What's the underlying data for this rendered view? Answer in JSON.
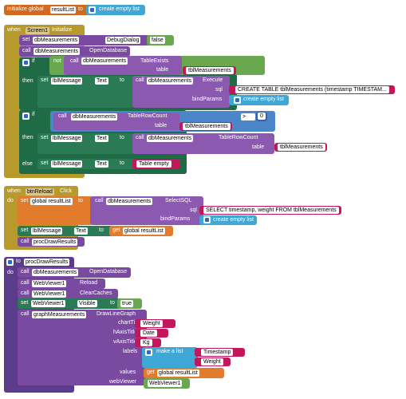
{
  "b1": {
    "initialize": "initialize global",
    "var": "resultList",
    "to": "to",
    "create": "create empty list"
  },
  "b2": {
    "when": "when",
    "component": "Screen1",
    "event": "Initialize",
    "do": "do",
    "set1": {
      "set": "set",
      "comp": "dbMeasurements",
      "prop": "DebugDialog",
      "to": "to",
      "value": "false"
    },
    "call1": {
      "call": "call",
      "comp": "dbMeasurements",
      "method": "OpenDatabase"
    },
    "if1": {
      "if": "if",
      "not": "not",
      "call": "call",
      "comp": "dbMeasurements",
      "method": "TableExists",
      "table": "table",
      "tbl": "tblMeasurements"
    },
    "then1": {
      "then": "then",
      "set": "set",
      "lbl": "lblMessage",
      "prop": "Text",
      "to": "to",
      "call": "call",
      "comp": "dbMeasurements",
      "method": "Execute",
      "sql": "sql",
      "sqlText": "CREATE TABLE tblMeasurements (timestamp TIMESTAM...",
      "bindParams": "bindParams",
      "create": "create empty list"
    },
    "if2": {
      "if": "if",
      "call": "call",
      "comp": "dbMeasurements",
      "method": "TableRowCount",
      "table": "table",
      "tbl": "tblMeasurements",
      "op": ">",
      "num": "0"
    },
    "then2": {
      "then": "then",
      "set": "set",
      "lbl": "lblMessage",
      "prop": "Text",
      "to": "to",
      "call": "call",
      "comp": "dbMeasurements",
      "method": "TableRowCount",
      "table": "table",
      "tbl": "tblMeasurements"
    },
    "else": {
      "else": "else",
      "set": "set",
      "lbl": "lblMessage",
      "prop": "Text",
      "to": "to",
      "str": "Table empty"
    }
  },
  "b3": {
    "when": "when",
    "component": "btnReload",
    "event": "Click",
    "do": "do",
    "set1": {
      "set": "set",
      "var": "global resultList",
      "to": "to",
      "call": "call",
      "comp": "dbMeasurements",
      "method": "SelectSQL",
      "sql": "sql",
      "sqlText": "SELECT timestamp, weight FROM tblMeasurements",
      "bindParams": "bindParams",
      "create": "create empty list"
    },
    "set2": {
      "set": "set",
      "lbl": "lblMessage",
      "prop": "Text",
      "to": "to",
      "get": "get",
      "var": "global resultList"
    },
    "call1": {
      "call": "call",
      "proc": "procDrawResults"
    }
  },
  "b4": {
    "to": "to",
    "proc": "procDrawResults",
    "do": "do",
    "l1": {
      "call": "call",
      "comp": "dbMeasurements",
      "method": "OpenDatabase"
    },
    "l2": {
      "call": "call",
      "comp": "WebViewer1",
      "method": "Reload"
    },
    "l3": {
      "call": "call",
      "comp": "WebViewer1",
      "method": "ClearCaches"
    },
    "l4": {
      "set": "set",
      "comp": "WebViewer1",
      "prop": "Visible",
      "to": "to",
      "value": "true"
    },
    "l5": {
      "call": "call",
      "comp": "graphMeasurements",
      "method": "DrawLineGraph",
      "chartTitle": "chartTitle",
      "chartTitleVal": "Weight",
      "hAxisTitle": "hAxisTitle",
      "hAxisVal": "Date",
      "vAxisTitle": "vAxisTitle",
      "vAxisVal": "Kg",
      "labels": "labels",
      "makeList": "make a list",
      "lab1": "Timestamp",
      "lab2": "Weight",
      "values": "values",
      "get": "get",
      "var": "global resultList",
      "webViewer": "webViewer",
      "wv": "WebViewer1"
    }
  }
}
